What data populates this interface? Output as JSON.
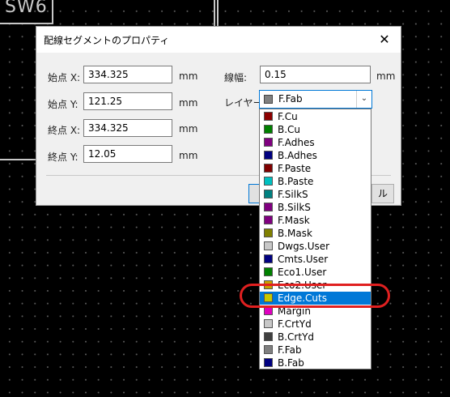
{
  "background": {
    "silkscreen_text": "SW6"
  },
  "dialog": {
    "title": "配線セグメントのプロパティ",
    "close_glyph": "✕",
    "fields": {
      "start_x": {
        "label": "始点 X:",
        "value": "334.325",
        "unit": "mm"
      },
      "start_y": {
        "label": "始点 Y:",
        "value": "121.25",
        "unit": "mm"
      },
      "end_x": {
        "label": "終点 X:",
        "value": "334.325",
        "unit": "mm"
      },
      "end_y": {
        "label": "終点 Y:",
        "value": "12.05",
        "unit": "mm"
      },
      "width": {
        "label": "線幅:",
        "value": "0.15",
        "unit": "mm"
      },
      "layer": {
        "label": "レイヤー:"
      }
    },
    "buttons": {
      "cancel_partial": "ル"
    }
  },
  "layer_combo": {
    "selected": "F.Fab",
    "selected_color": "#808080"
  },
  "layer_list": [
    {
      "name": "F.Cu",
      "color": "#8c0000"
    },
    {
      "name": "B.Cu",
      "color": "#008000"
    },
    {
      "name": "F.Adhes",
      "color": "#800080"
    },
    {
      "name": "B.Adhes",
      "color": "#000080"
    },
    {
      "name": "F.Paste",
      "color": "#800000"
    },
    {
      "name": "B.Paste",
      "color": "#00c0c0"
    },
    {
      "name": "F.SilkS",
      "color": "#008080"
    },
    {
      "name": "B.SilkS",
      "color": "#800080"
    },
    {
      "name": "F.Mask",
      "color": "#800080"
    },
    {
      "name": "B.Mask",
      "color": "#808000"
    },
    {
      "name": "Dwgs.User",
      "color": "#c8c8c8"
    },
    {
      "name": "Cmts.User",
      "color": "#000080"
    },
    {
      "name": "Eco1.User",
      "color": "#008000"
    },
    {
      "name": "Eco2.User",
      "color": "#c8a000"
    },
    {
      "name": "Edge.Cuts",
      "color": "#c8c800"
    },
    {
      "name": "Margin",
      "color": "#e000c0"
    },
    {
      "name": "F.CrtYd",
      "color": "#c8c8c8"
    },
    {
      "name": "B.CrtYd",
      "color": "#404040"
    },
    {
      "name": "F.Fab",
      "color": "#808080"
    },
    {
      "name": "B.Fab",
      "color": "#000080"
    }
  ],
  "selected_layer": "Edge.Cuts",
  "annotation_color": "#e02020"
}
